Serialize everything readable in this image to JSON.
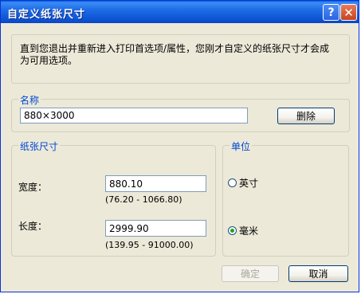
{
  "window": {
    "title": "自定义纸张尺寸",
    "help_glyph": "?",
    "close_glyph": "✕"
  },
  "info": {
    "text": "直到您退出并重新进入打印首选项/属性，您刚才自定义的纸张尺寸才会成为可用选项。"
  },
  "name_group": {
    "label": "名称",
    "value": "880×3000",
    "delete_button": "删除"
  },
  "size_group": {
    "label": "纸张尺寸",
    "width_label": "宽度：",
    "width_value": "880.10",
    "width_range": "(76.20 - 1066.80)",
    "length_label": "长度：",
    "length_value": "2999.90",
    "length_range": "(139.95 - 91000.00)"
  },
  "unit_group": {
    "label": "单位",
    "options": [
      {
        "label": "英寸",
        "selected": false
      },
      {
        "label": "毫米",
        "selected": true
      }
    ]
  },
  "buttons": {
    "ok": "确定",
    "ok_enabled": false,
    "cancel": "取消"
  }
}
